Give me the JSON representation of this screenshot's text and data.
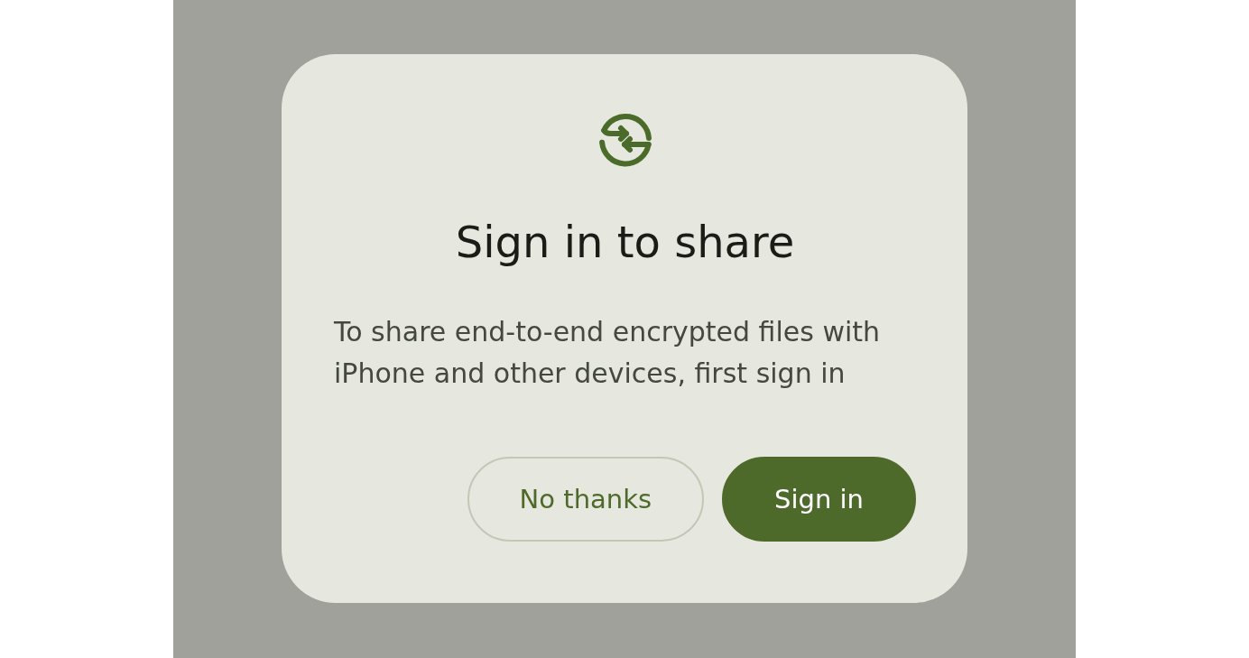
{
  "dialog": {
    "title": "Sign in to share",
    "message": "To share end-to-end encrypted files with iPhone and other devices, first sign in",
    "buttons": [
      {
        "label": "No thanks",
        "kind": "outlined"
      },
      {
        "label": "Sign in",
        "kind": "filled"
      }
    ]
  }
}
